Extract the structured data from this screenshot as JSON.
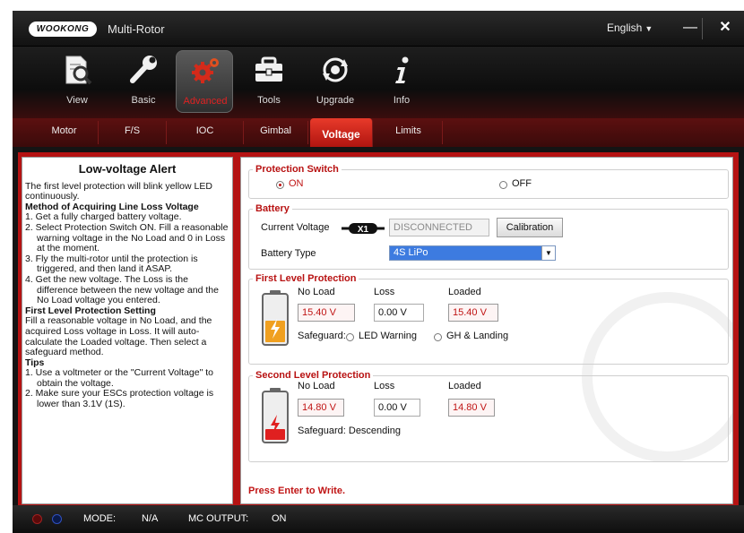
{
  "titlebar": {
    "logo_text": "WOOKONG",
    "app_name": "Multi-Rotor",
    "language": "English",
    "minimize_symbol": "—",
    "close_symbol": "✕"
  },
  "toolbar": {
    "items": [
      {
        "label": "View",
        "icon": "view-icon"
      },
      {
        "label": "Basic",
        "icon": "wrench-icon"
      },
      {
        "label": "Advanced",
        "icon": "gears-icon",
        "active": true
      },
      {
        "label": "Tools",
        "icon": "toolbox-icon"
      },
      {
        "label": "Upgrade",
        "icon": "upgrade-icon"
      },
      {
        "label": "Info",
        "icon": "info-icon"
      }
    ]
  },
  "tabs": [
    {
      "label": "Motor"
    },
    {
      "label": "F/S"
    },
    {
      "label": "IOC"
    },
    {
      "label": "Gimbal"
    },
    {
      "label": "Voltage",
      "active": true
    },
    {
      "label": "Limits"
    }
  ],
  "help": {
    "title": "Low-voltage Alert",
    "intro": "The first level protection will blink yellow LED continuously.",
    "method_heading": "Method of Acquiring Line Loss Voltage",
    "method_steps": [
      "1.  Get a fully charged battery voltage.",
      "2.  Select Protection Switch ON. Fill a reasonable warning voltage in the No Load and 0 in Loss at the moment.",
      "3.  Fly the multi-rotor until the protection is triggered, and then land it ASAP.",
      "4.  Get the new voltage. The Loss is the difference between the new voltage and the No Load voltage you entered."
    ],
    "first_heading": "First Level Protection Setting",
    "first_text": "Fill a reasonable voltage in No Load, and the acquired Loss voltage in Loss. It will auto-calculate the Loaded voltage. Then select a safeguard method.",
    "tips_heading": "Tips",
    "tips": [
      "1.  Use a voltmeter or the \"Current Voltage\" to obtain the voltage.",
      "2.  Make sure your ESCs protection voltage is lower than 3.1V (1S)."
    ]
  },
  "protection_switch": {
    "legend": "Protection Switch",
    "on_label": "ON",
    "off_label": "OFF",
    "selected": "ON"
  },
  "battery": {
    "legend": "Battery",
    "current_voltage_label": "Current Voltage",
    "multiplier": "X1",
    "current_voltage_value": "DISCONNECTED",
    "calibration_label": "Calibration",
    "battery_type_label": "Battery Type",
    "battery_type_value": "4S LiPo"
  },
  "first_level": {
    "legend": "First Level Protection",
    "no_load_label": "No Load",
    "loss_label": "Loss",
    "loaded_label": "Loaded",
    "no_load_value": "15.40 V",
    "loss_value": "0.00 V",
    "loaded_value": "15.40 V",
    "safeguard_label": "Safeguard:",
    "safeguard_options": [
      "LED Warning",
      "GH & Landing"
    ],
    "safeguard_selected": "none",
    "battery_color": "#f0a020"
  },
  "second_level": {
    "legend": "Second Level Protection",
    "no_load_label": "No Load",
    "loss_label": "Loss",
    "loaded_label": "Loaded",
    "no_load_value": "14.80 V",
    "loss_value": "0.00 V",
    "loaded_value": "14.80 V",
    "safeguard_text": "Safeguard:  Descending",
    "battery_color": "#e02020"
  },
  "press_enter": "Press Enter to Write.",
  "statusbar": {
    "mode_label": "MODE:",
    "mode_value": "N/A",
    "mc_output_label": "MC OUTPUT:",
    "mc_output_value": "ON"
  },
  "colors": {
    "accent_red": "#c01414",
    "content_background": "#b51313",
    "tab_active": "#e83a2a",
    "select_highlight": "#3d7be0"
  }
}
